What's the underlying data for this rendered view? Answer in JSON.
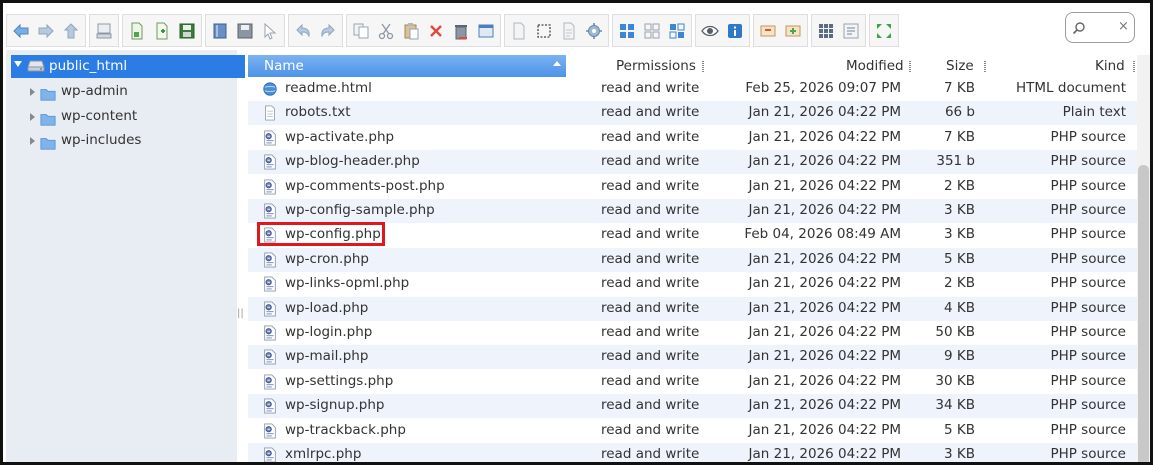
{
  "colors": {
    "accent": "#2b7de5",
    "header_gradient_top": "#7bb2f2",
    "row_alt": "#eef3fc",
    "highlight": "#e0181e",
    "tree_bg": "#e8edf3"
  },
  "toolbar": {
    "groups": [
      [
        "arrow-left-icon",
        "arrow-right-icon",
        "arrow-up-icon"
      ],
      [
        "computer-icon"
      ],
      [
        "new-file-icon",
        "add-file-icon",
        "save-icon"
      ],
      [
        "book-icon",
        "disk-icon",
        "cursor-icon"
      ],
      [
        "undo-icon",
        "redo-icon"
      ],
      [
        "copy-icon",
        "cut-icon",
        "paste-icon",
        "delete-icon",
        "trash-icon",
        "window-icon"
      ],
      [
        "blank-page-icon",
        "select-icon",
        "page-icon",
        "gear-icon"
      ],
      [
        "grid-view-icon",
        "small-grid-icon",
        "tiles-view-icon"
      ],
      [
        "eye-icon",
        "info-icon"
      ],
      [
        "extract-icon",
        "archive-icon"
      ],
      [
        "thumbnails-icon",
        "text-icon"
      ],
      [
        "fullscreen-icon"
      ]
    ]
  },
  "search": {
    "placeholder": "",
    "value": "",
    "clear_label": "×"
  },
  "tree": {
    "root": "public_html",
    "items": [
      {
        "label": "wp-admin"
      },
      {
        "label": "wp-content"
      },
      {
        "label": "wp-includes"
      }
    ],
    "splitter_glyph": "||"
  },
  "file_list": {
    "columns": {
      "name": "Name",
      "permissions": "Permissions",
      "modified": "Modified",
      "size": "Size",
      "kind": "Kind"
    },
    "rows": [
      {
        "name": "readme.html",
        "permissions": "read and write",
        "modified": "Feb 25, 2026 09:07 PM",
        "size": "7 KB",
        "kind": "HTML document",
        "icon": "html-globe-icon"
      },
      {
        "name": "robots.txt",
        "permissions": "read and write",
        "modified": "Jan 21, 2026 04:22 PM",
        "size": "66 b",
        "kind": "Plain text",
        "icon": "text-file-icon"
      },
      {
        "name": "wp-activate.php",
        "permissions": "read and write",
        "modified": "Jan 21, 2026 04:22 PM",
        "size": "7 KB",
        "kind": "PHP source",
        "icon": "php-file-icon"
      },
      {
        "name": "wp-blog-header.php",
        "permissions": "read and write",
        "modified": "Jan 21, 2026 04:22 PM",
        "size": "351 b",
        "kind": "PHP source",
        "icon": "php-file-icon"
      },
      {
        "name": "wp-comments-post.php",
        "permissions": "read and write",
        "modified": "Jan 21, 2026 04:22 PM",
        "size": "2 KB",
        "kind": "PHP source",
        "icon": "php-file-icon"
      },
      {
        "name": "wp-config-sample.php",
        "permissions": "read and write",
        "modified": "Jan 21, 2026 04:22 PM",
        "size": "3 KB",
        "kind": "PHP source",
        "icon": "php-file-icon"
      },
      {
        "name": "wp-config.php",
        "permissions": "read and write",
        "modified": "Feb 04, 2026 08:49 AM",
        "size": "3 KB",
        "kind": "PHP source",
        "icon": "php-file-icon",
        "highlighted": true
      },
      {
        "name": "wp-cron.php",
        "permissions": "read and write",
        "modified": "Jan 21, 2026 04:22 PM",
        "size": "5 KB",
        "kind": "PHP source",
        "icon": "php-file-icon"
      },
      {
        "name": "wp-links-opml.php",
        "permissions": "read and write",
        "modified": "Jan 21, 2026 04:22 PM",
        "size": "2 KB",
        "kind": "PHP source",
        "icon": "php-file-icon"
      },
      {
        "name": "wp-load.php",
        "permissions": "read and write",
        "modified": "Jan 21, 2026 04:22 PM",
        "size": "4 KB",
        "kind": "PHP source",
        "icon": "php-file-icon"
      },
      {
        "name": "wp-login.php",
        "permissions": "read and write",
        "modified": "Jan 21, 2026 04:22 PM",
        "size": "50 KB",
        "kind": "PHP source",
        "icon": "php-file-icon"
      },
      {
        "name": "wp-mail.php",
        "permissions": "read and write",
        "modified": "Jan 21, 2026 04:22 PM",
        "size": "9 KB",
        "kind": "PHP source",
        "icon": "php-file-icon"
      },
      {
        "name": "wp-settings.php",
        "permissions": "read and write",
        "modified": "Jan 21, 2026 04:22 PM",
        "size": "30 KB",
        "kind": "PHP source",
        "icon": "php-file-icon"
      },
      {
        "name": "wp-signup.php",
        "permissions": "read and write",
        "modified": "Jan 21, 2026 04:22 PM",
        "size": "34 KB",
        "kind": "PHP source",
        "icon": "php-file-icon"
      },
      {
        "name": "wp-trackback.php",
        "permissions": "read and write",
        "modified": "Jan 21, 2026 04:22 PM",
        "size": "5 KB",
        "kind": "PHP source",
        "icon": "php-file-icon"
      },
      {
        "name": "xmlrpc.php",
        "permissions": "read and write",
        "modified": "Jan 21, 2026 04:22 PM",
        "size": "3 KB",
        "kind": "PHP source",
        "icon": "php-file-icon"
      }
    ]
  }
}
